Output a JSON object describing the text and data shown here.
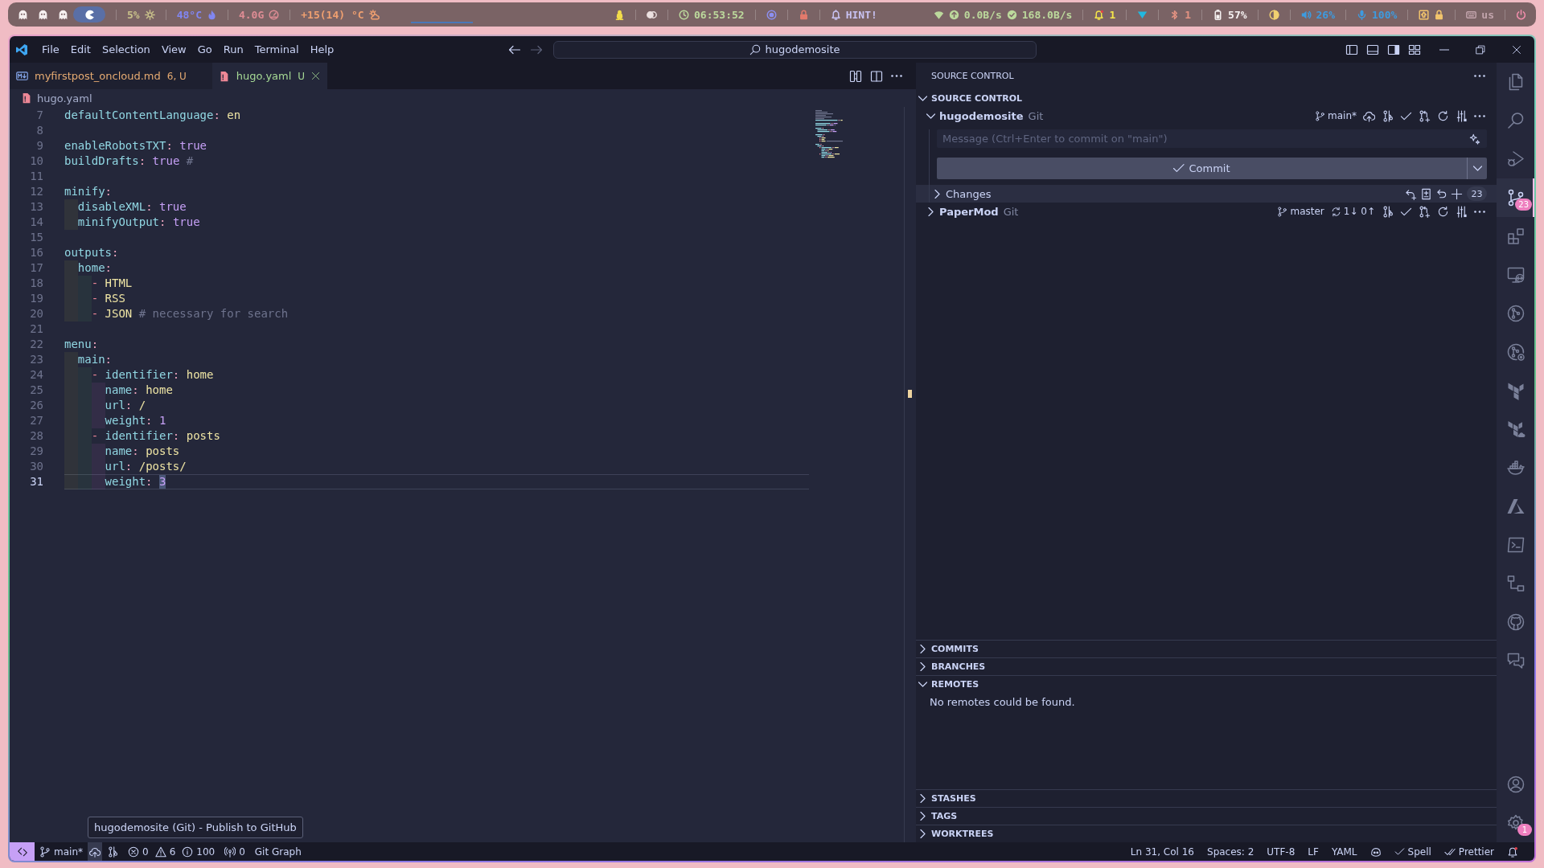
{
  "system_bar": {
    "workspaces": [
      {
        "selected": false
      },
      {
        "selected": false
      },
      {
        "selected": false
      },
      {
        "selected": true
      }
    ],
    "left_modules": [
      {
        "kind": "cpu",
        "text": "5%",
        "color": "#c8c08a"
      },
      {
        "kind": "temperature",
        "text": "48°C",
        "color": "#8186f2"
      },
      {
        "kind": "memory",
        "text": "4.0G",
        "color": "#de8c94"
      },
      {
        "kind": "weather",
        "text": "+15(14) °C",
        "color": "#f0a070"
      }
    ],
    "right_modules": [
      {
        "kind": "updates",
        "color": "#f2dc4a"
      },
      {
        "kind": "idle",
        "color": "#ebe0e0"
      },
      {
        "kind": "clock",
        "text": "06:53:52",
        "color": "#bcd99c"
      },
      {
        "kind": "privacy",
        "color": "#8c8ff0"
      },
      {
        "kind": "lock",
        "color": "#e27a6c"
      },
      {
        "kind": "hint",
        "text": "HINT!",
        "color": "#c8c2f2"
      },
      {
        "kind": "network",
        "upload": "0.0B/s",
        "download": "168.0B/s",
        "color": "#bcd99c"
      },
      {
        "kind": "notifications",
        "text": "1",
        "color": "#f5e64a"
      },
      {
        "kind": "wifi",
        "color": "#22b8e0"
      },
      {
        "kind": "bluetooth",
        "text": "1",
        "color": "#e39282"
      },
      {
        "kind": "battery",
        "text": "57%",
        "color": "#f6f2f2"
      },
      {
        "kind": "brightness",
        "color": "#f0d070"
      },
      {
        "kind": "volume",
        "text": "26%",
        "color": "#3d9be0"
      },
      {
        "kind": "microphone",
        "text": "100%",
        "color": "#3d9be0"
      },
      {
        "kind": "keyboard-state",
        "color": "#f2c46c"
      },
      {
        "kind": "layout",
        "text": "us",
        "color": "#c2a4ac"
      },
      {
        "kind": "power",
        "color": "#f58fae"
      }
    ]
  },
  "window": {
    "menu": [
      "File",
      "Edit",
      "Selection",
      "View",
      "Go",
      "Run",
      "Terminal",
      "Help"
    ],
    "nav": [
      {
        "kind": "back",
        "disabled": false
      },
      {
        "kind": "forward",
        "disabled": true
      }
    ],
    "command_center": "hugodemosite",
    "layout_toggles": [
      {
        "kind": "primary-sidebar",
        "on": false
      },
      {
        "kind": "panel",
        "on": false
      },
      {
        "kind": "secondary-sidebar",
        "on": true
      }
    ]
  },
  "editor": {
    "tabs": [
      {
        "label": "myfirstpost_oncloud.md",
        "decoration": "6, U",
        "kind": "markdown",
        "color": "#e6ab72",
        "selected": false
      },
      {
        "label": "hugo.yaml",
        "decoration": "U",
        "kind": "yaml",
        "color": "#a6da95",
        "selected": true
      }
    ],
    "breadcrumb": [
      {
        "label": "hugo.yaml",
        "kind": "yaml"
      }
    ],
    "lines": [
      {
        "number": "7",
        "current": false,
        "tokens": [
          {
            "kind": "key",
            "text": "defaultContentLanguage",
            "highlighted": false
          },
          {
            "kind": "colon",
            "text": ":",
            "highlighted": false
          },
          {
            "kind": "string",
            "text": "en",
            "highlighted": false
          }
        ]
      },
      {
        "number": "8",
        "current": false
      },
      {
        "number": "9",
        "current": false,
        "tokens": [
          {
            "kind": "key",
            "text": "enableRobotsTXT",
            "highlighted": false
          },
          {
            "kind": "colon",
            "text": ":",
            "highlighted": false
          },
          {
            "kind": "boolean",
            "text": "true",
            "highlighted": false
          }
        ]
      },
      {
        "number": "10",
        "current": false,
        "tokens": [
          {
            "kind": "key",
            "text": "buildDrafts",
            "highlighted": false
          },
          {
            "kind": "colon",
            "text": ":",
            "highlighted": false
          },
          {
            "kind": "boolean",
            "text": "true",
            "highlighted": false
          },
          {
            "kind": "comment",
            "text": "#",
            "highlighted": false
          }
        ]
      },
      {
        "number": "11",
        "current": false
      },
      {
        "number": "12",
        "current": false,
        "tokens": [
          {
            "kind": "key",
            "text": "minify",
            "highlighted": false
          },
          {
            "kind": "colon",
            "text": ":",
            "highlighted": false
          }
        ],
        "children": [
          {
            "number": "13",
            "current": false,
            "tokens": [
              {
                "kind": "key",
                "text": "disableXML",
                "highlighted": false
              },
              {
                "kind": "colon",
                "text": ":",
                "highlighted": false
              },
              {
                "kind": "boolean",
                "text": "true",
                "highlighted": false
              }
            ]
          },
          {
            "number": "14",
            "current": false,
            "tokens": [
              {
                "kind": "key",
                "text": "minifyOutput",
                "highlighted": false
              },
              {
                "kind": "colon",
                "text": ":",
                "highlighted": false
              },
              {
                "kind": "boolean",
                "text": "true",
                "highlighted": false
              }
            ]
          }
        ]
      },
      {
        "number": "15",
        "current": false
      },
      {
        "number": "16",
        "current": false,
        "tokens": [
          {
            "kind": "key",
            "text": "outputs",
            "highlighted": false
          },
          {
            "kind": "colon",
            "text": ":",
            "highlighted": false
          }
        ],
        "children": [
          {
            "number": "17",
            "current": false,
            "tokens": [
              {
                "kind": "key",
                "text": "home",
                "highlighted": false
              },
              {
                "kind": "colon",
                "text": ":",
                "highlighted": false
              }
            ],
            "children": [
              {
                "number": "18",
                "current": false,
                "tokens": [
                  {
                    "kind": "dash",
                    "text": "-",
                    "highlighted": false
                  },
                  {
                    "kind": "string",
                    "text": "HTML",
                    "highlighted": false
                  }
                ]
              },
              {
                "number": "19",
                "current": false,
                "tokens": [
                  {
                    "kind": "dash",
                    "text": "-",
                    "highlighted": false
                  },
                  {
                    "kind": "string",
                    "text": "RSS",
                    "highlighted": false
                  }
                ]
              },
              {
                "number": "20",
                "current": false,
                "tokens": [
                  {
                    "kind": "dash",
                    "text": "-",
                    "highlighted": false
                  },
                  {
                    "kind": "string",
                    "text": "JSON",
                    "highlighted": false
                  },
                  {
                    "kind": "comment",
                    "text": "# necessary for search",
                    "highlighted": false
                  }
                ]
              }
            ]
          }
        ]
      },
      {
        "number": "21",
        "current": false
      },
      {
        "number": "22",
        "current": false,
        "tokens": [
          {
            "kind": "key",
            "text": "menu",
            "highlighted": false
          },
          {
            "kind": "colon",
            "text": ":",
            "highlighted": false
          }
        ],
        "children": [
          {
            "number": "23",
            "current": false,
            "tokens": [
              {
                "kind": "key",
                "text": "main",
                "highlighted": false
              },
              {
                "kind": "colon",
                "text": ":",
                "highlighted": false
              }
            ],
            "children": [
              {
                "number": "24",
                "current": false,
                "tokens": [
                  {
                    "kind": "dash",
                    "text": "-",
                    "highlighted": false
                  },
                  {
                    "kind": "key",
                    "text": "identifier",
                    "highlighted": false
                  },
                  {
                    "kind": "colon",
                    "text": ":",
                    "highlighted": false
                  },
                  {
                    "kind": "string",
                    "text": "home",
                    "highlighted": false
                  }
                ],
                "children": [
                  {
                    "number": "25",
                    "current": false,
                    "tokens": [
                      {
                        "kind": "key",
                        "text": "name",
                        "highlighted": false
                      },
                      {
                        "kind": "colon",
                        "text": ":",
                        "highlighted": false
                      },
                      {
                        "kind": "string",
                        "text": "home",
                        "highlighted": false
                      }
                    ]
                  },
                  {
                    "number": "26",
                    "current": false,
                    "tokens": [
                      {
                        "kind": "key",
                        "text": "url",
                        "highlighted": false
                      },
                      {
                        "kind": "colon",
                        "text": ":",
                        "highlighted": false
                      },
                      {
                        "kind": "string",
                        "text": "/",
                        "highlighted": false
                      }
                    ]
                  },
                  {
                    "number": "27",
                    "current": false,
                    "tokens": [
                      {
                        "kind": "key",
                        "text": "weight",
                        "highlighted": false
                      },
                      {
                        "kind": "colon",
                        "text": ":",
                        "highlighted": false
                      },
                      {
                        "kind": "number",
                        "text": "1",
                        "highlighted": false
                      }
                    ]
                  }
                ]
              },
              {
                "number": "28",
                "current": false,
                "tokens": [
                  {
                    "kind": "dash",
                    "text": "-",
                    "highlighted": false
                  },
                  {
                    "kind": "key",
                    "text": "identifier",
                    "highlighted": false
                  },
                  {
                    "kind": "colon",
                    "text": ":",
                    "highlighted": false
                  },
                  {
                    "kind": "string",
                    "text": "posts",
                    "highlighted": false
                  }
                ],
                "children": [
                  {
                    "number": "29",
                    "current": false,
                    "tokens": [
                      {
                        "kind": "key",
                        "text": "name",
                        "highlighted": false
                      },
                      {
                        "kind": "colon",
                        "text": ":",
                        "highlighted": false
                      },
                      {
                        "kind": "string",
                        "text": "posts",
                        "highlighted": false
                      }
                    ]
                  },
                  {
                    "number": "30",
                    "current": false,
                    "tokens": [
                      {
                        "kind": "key",
                        "text": "url",
                        "highlighted": false
                      },
                      {
                        "kind": "colon",
                        "text": ":",
                        "highlighted": false
                      },
                      {
                        "kind": "string",
                        "text": "/posts/",
                        "highlighted": false
                      }
                    ]
                  },
                  {
                    "number": "31",
                    "current": true,
                    "tokens": [
                      {
                        "kind": "key",
                        "text": "weight",
                        "highlighted": false
                      },
                      {
                        "kind": "colon",
                        "text": ":",
                        "highlighted": false
                      },
                      {
                        "kind": "number",
                        "text": "3",
                        "highlighted": true
                      }
                    ]
                  }
                ]
              }
            ]
          }
        ]
      }
    ]
  },
  "source_control": {
    "title": "SOURCE CONTROL",
    "section": {
      "label": "SOURCE CONTROL",
      "expanded": true
    },
    "repositories": [
      {
        "name": "hugodemosite",
        "provider": "Git",
        "branch": "main*",
        "expanded": true,
        "message_field": {
          "placeholder": "Message (Ctrl+Enter to commit on \"main\")"
        },
        "commit_label": "Commit",
        "groups": [
          {
            "label": "Changes",
            "count": "23",
            "expanded": false,
            "selected": true
          }
        ]
      },
      {
        "name": "PaperMod",
        "provider": "Git",
        "branch": "master",
        "sync": "1↓ 0↑",
        "expanded": false
      }
    ],
    "views": [
      {
        "label": "COMMITS",
        "expanded": false
      },
      {
        "label": "BRANCHES",
        "expanded": false
      },
      {
        "label": "REMOTES",
        "expanded": true,
        "message": "No remotes could be found."
      },
      {
        "label": "STASHES",
        "expanded": false
      },
      {
        "label": "TAGS",
        "expanded": false
      },
      {
        "label": "WORKTREES",
        "expanded": false
      }
    ]
  },
  "activity_bar": {
    "items": [
      {
        "kind": "explorer",
        "selected": false
      },
      {
        "kind": "search",
        "selected": false
      },
      {
        "kind": "run-debug",
        "selected": false
      },
      {
        "kind": "source-control",
        "selected": true,
        "badge": "23"
      },
      {
        "kind": "extensions",
        "selected": false
      },
      {
        "kind": "remote-explorer",
        "selected": false
      },
      {
        "kind": "git-circle",
        "selected": false
      },
      {
        "kind": "git-circle-gear",
        "selected": false
      },
      {
        "kind": "blocks",
        "selected": false
      },
      {
        "kind": "blocks-cloud",
        "selected": false
      },
      {
        "kind": "whale",
        "selected": false
      },
      {
        "kind": "peak",
        "selected": false
      },
      {
        "kind": "terminal",
        "selected": false
      },
      {
        "kind": "nodes",
        "selected": false
      },
      {
        "kind": "cat-circle",
        "selected": false
      },
      {
        "kind": "chat",
        "selected": false
      }
    ],
    "bottom": [
      {
        "kind": "accounts"
      },
      {
        "kind": "manage",
        "badge": "1"
      }
    ]
  },
  "status_bar": {
    "left": [
      {
        "kind": "remote",
        "hovered": false
      },
      {
        "kind": "branch",
        "text": "main*",
        "hovered": false
      },
      {
        "kind": "publish",
        "hovered": true
      },
      {
        "kind": "graph",
        "hovered": false
      },
      {
        "kind": "problems",
        "errors": "0",
        "warnings": "6",
        "infos": "100",
        "hovered": false
      },
      {
        "kind": "ports",
        "text": "0",
        "hovered": false
      },
      {
        "kind": "text",
        "text": "Git Graph",
        "hovered": false
      }
    ],
    "right": [
      {
        "kind": "text",
        "text": "Ln 31, Col 16"
      },
      {
        "kind": "text",
        "text": "Spaces: 2"
      },
      {
        "kind": "text",
        "text": "UTF-8"
      },
      {
        "kind": "text",
        "text": "LF"
      },
      {
        "kind": "text",
        "text": "YAML"
      },
      {
        "kind": "copilot"
      },
      {
        "kind": "check",
        "text": "Spell"
      },
      {
        "kind": "check-all",
        "text": "Prettier"
      },
      {
        "kind": "notifications"
      }
    ]
  },
  "tooltip": {
    "text": "hugodemosite (Git) - Publish to GitHub"
  }
}
